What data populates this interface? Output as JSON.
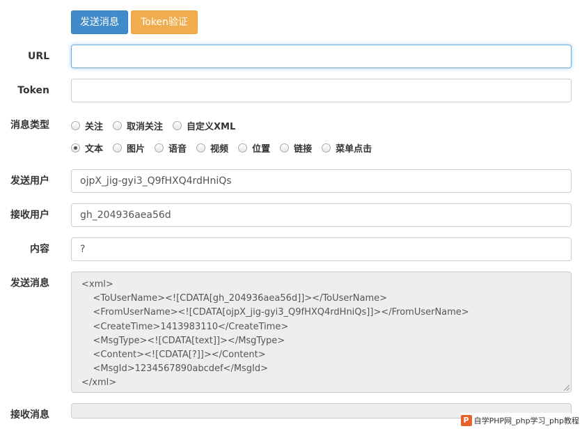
{
  "toolbar": {
    "send_label": "发送消息",
    "token_label": "Token验证"
  },
  "colors": {
    "primary": "#428bca",
    "warning": "#f0ad4e",
    "focus": "#66afe9",
    "readonly_bg": "#eeeeee"
  },
  "form": {
    "url": {
      "label": "URL",
      "value": ""
    },
    "token": {
      "label": "Token",
      "value": ""
    },
    "msg_type": {
      "label": "消息类型",
      "row1": [
        "关注",
        "取消关注",
        "自定义XML"
      ],
      "row2": [
        "文本",
        "图片",
        "语音",
        "视频",
        "位置",
        "链接",
        "菜单点击"
      ],
      "selected": "文本"
    },
    "from_user": {
      "label": "发送用户",
      "value": "ojpX_jig-gyi3_Q9fHXQ4rdHniQs"
    },
    "to_user": {
      "label": "接收用户",
      "value": "gh_204936aea56d"
    },
    "content": {
      "label": "内容",
      "value": "?"
    },
    "send_msg": {
      "label": "发送消息",
      "lines": [
        "<xml>",
        "    <ToUserName><![CDATA[gh_204936aea56d]]></ToUserName>",
        "    <FromUserName><![CDATA[ojpX_jig-gyi3_Q9fHXQ4rdHniQs]]></FromUserName>",
        "    <CreateTime>1413983110</CreateTime>",
        "    <MsgType><![CDATA[text]]></MsgType>",
        "    <Content><![CDATA[?]]></Content>",
        "    <MsgId>1234567890abcdef</MsgId>",
        "</xml>"
      ]
    },
    "recv_msg": {
      "label": "接收消息",
      "value": ""
    }
  },
  "watermark": {
    "logo": "P",
    "text": "自学PHP网_php学习_php教程"
  }
}
